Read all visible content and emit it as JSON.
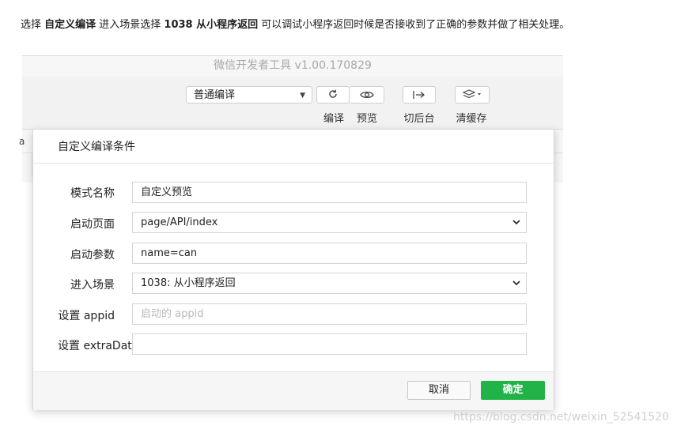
{
  "intro": {
    "p1": "选择 ",
    "b1": "自定义编译",
    "p2": " 进入场景选择 ",
    "b2": "1038 从小程序返回",
    "p3": " 可以调试小程序返回时候是否接收到了正确的参数并做了相关处理。"
  },
  "window": {
    "title": "微信开发者工具 v1.00.170829",
    "compile_mode": "普通编译",
    "toolbar": {
      "compile_label": "编译",
      "preview_label": "预览",
      "background_label": "切后台",
      "clear_cache_label": "清缓存"
    },
    "side_letter": "a"
  },
  "dialog": {
    "title": "自定义编译条件",
    "fields": [
      {
        "label": "模式名称",
        "value": "自定义预览",
        "placeholder": ""
      },
      {
        "label": "启动页面",
        "value": "page/API/index",
        "placeholder": ""
      },
      {
        "label": "启动参数",
        "value": "name=can",
        "placeholder": ""
      },
      {
        "label": "进入场景",
        "value": "1038: 从小程序返回",
        "placeholder": ""
      },
      {
        "label": "设置 appid",
        "value": "",
        "placeholder": "启动的 appid"
      },
      {
        "label": "设置 extraData",
        "value": "",
        "placeholder": ""
      }
    ],
    "cancel_label": "取消",
    "ok_label": "确定"
  },
  "watermark": "https://blog.csdn.net/weixin_52541520",
  "colors": {
    "accent_green": "#21b348"
  }
}
